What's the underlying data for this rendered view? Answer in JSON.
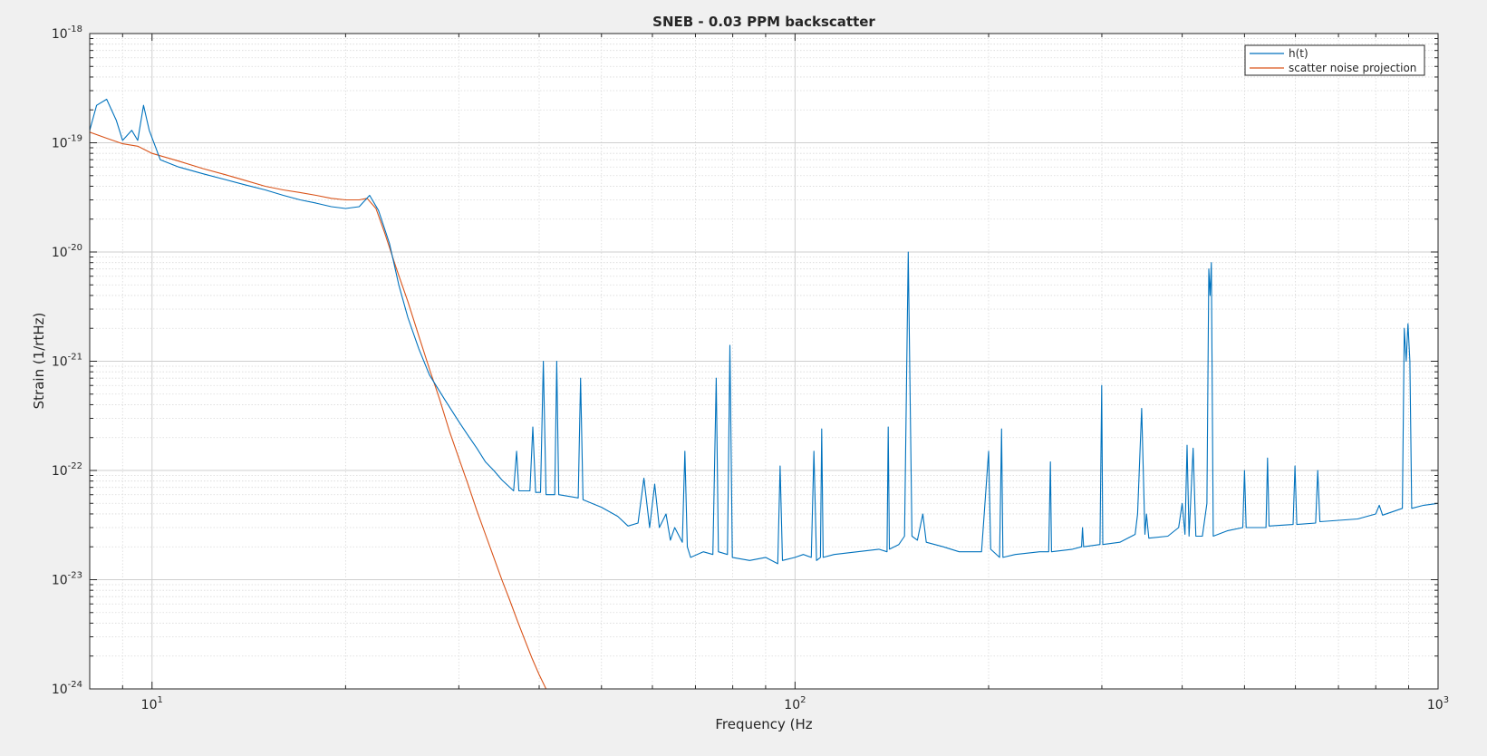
{
  "chart_data": {
    "type": "line",
    "title": "SNEB - 0.03 PPM backscatter",
    "xlabel": "Frequency (Hz",
    "ylabel": "Strain (1/rtHz)",
    "xscale": "log",
    "yscale": "log",
    "xlim": [
      8,
      1000
    ],
    "ylim": [
      1e-24,
      1e-18
    ],
    "grid": true,
    "minor_grid": true,
    "legend_position": "top-right",
    "x_ticks": [
      {
        "value": 10,
        "base": "10",
        "exp": "1"
      },
      {
        "value": 100,
        "base": "10",
        "exp": "2"
      },
      {
        "value": 1000,
        "base": "10",
        "exp": "3"
      }
    ],
    "y_ticks": [
      {
        "value": 1e-18,
        "base": "10",
        "exp": "-18"
      },
      {
        "value": 1e-19,
        "base": "10",
        "exp": "-19"
      },
      {
        "value": 1e-20,
        "base": "10",
        "exp": "-20"
      },
      {
        "value": 1e-21,
        "base": "10",
        "exp": "-21"
      },
      {
        "value": 1e-22,
        "base": "10",
        "exp": "-22"
      },
      {
        "value": 1e-23,
        "base": "10",
        "exp": "-23"
      },
      {
        "value": 1e-24,
        "base": "10",
        "exp": "-24"
      }
    ],
    "series": [
      {
        "name": "h(t)",
        "color": "#0072bd",
        "points": [
          [
            8,
            1.3e-19
          ],
          [
            8.2,
            2.2e-19
          ],
          [
            8.5,
            2.5e-19
          ],
          [
            8.8,
            1.6e-19
          ],
          [
            9.0,
            1.05e-19
          ],
          [
            9.3,
            1.3e-19
          ],
          [
            9.5,
            1.05e-19
          ],
          [
            9.7,
            2.2e-19
          ],
          [
            9.9,
            1.3e-19
          ],
          [
            10.3,
            7e-20
          ],
          [
            11,
            6e-20
          ],
          [
            12,
            5.2e-20
          ],
          [
            13,
            4.6e-20
          ],
          [
            14,
            4.1e-20
          ],
          [
            15,
            3.7e-20
          ],
          [
            16,
            3.3e-20
          ],
          [
            17,
            3e-20
          ],
          [
            18,
            2.8e-20
          ],
          [
            19,
            2.6e-20
          ],
          [
            20,
            2.5e-20
          ],
          [
            21,
            2.6e-20
          ],
          [
            21.8,
            3.3e-20
          ],
          [
            22.5,
            2.4e-20
          ],
          [
            23.4,
            1.2e-20
          ],
          [
            24.2,
            5e-21
          ],
          [
            25,
            2.5e-21
          ],
          [
            26,
            1.3e-21
          ],
          [
            27,
            7.5e-22
          ],
          [
            28.5,
            4.5e-22
          ],
          [
            30,
            2.8e-22
          ],
          [
            31,
            2.1e-22
          ],
          [
            32,
            1.6e-22
          ],
          [
            33,
            1.2e-22
          ],
          [
            34,
            1e-22
          ],
          [
            35,
            8.2e-23
          ],
          [
            36.5,
            6.5e-23
          ],
          [
            36.9,
            1.5e-22
          ],
          [
            37.2,
            6.5e-23
          ],
          [
            38.7,
            6.5e-23
          ],
          [
            39.1,
            2.5e-22
          ],
          [
            39.5,
            6.3e-23
          ],
          [
            40.2,
            6.3e-23
          ],
          [
            40.6,
            1e-21
          ],
          [
            41.0,
            6e-23
          ],
          [
            42.3,
            6e-23
          ],
          [
            42.6,
            1e-21
          ],
          [
            42.9,
            6e-23
          ],
          [
            46,
            5.6e-23
          ],
          [
            46.4,
            7e-22
          ],
          [
            46.8,
            5.4e-23
          ],
          [
            50,
            4.6e-23
          ],
          [
            53,
            3.8e-23
          ],
          [
            55,
            3.1e-23
          ],
          [
            57,
            3.3e-23
          ],
          [
            58.2,
            8.5e-23
          ],
          [
            59.4,
            3e-23
          ],
          [
            60.5,
            7.5e-23
          ],
          [
            61.5,
            3e-23
          ],
          [
            63,
            4e-23
          ],
          [
            64,
            2.3e-23
          ],
          [
            65,
            3e-23
          ],
          [
            66.8,
            2.2e-23
          ],
          [
            67.4,
            1.5e-22
          ],
          [
            68,
            2e-23
          ],
          [
            68.8,
            1.6e-23
          ],
          [
            72,
            1.8e-23
          ],
          [
            74.5,
            1.7e-23
          ],
          [
            75.4,
            7e-22
          ],
          [
            76.0,
            1.8e-23
          ],
          [
            78.5,
            1.7e-23
          ],
          [
            79.2,
            1.4e-21
          ],
          [
            79.9,
            1.6e-23
          ],
          [
            85,
            1.5e-23
          ],
          [
            90,
            1.6e-23
          ],
          [
            94,
            1.4e-23
          ],
          [
            94.8,
            1.1e-22
          ],
          [
            95.6,
            1.5e-23
          ],
          [
            100,
            1.6e-23
          ],
          [
            103,
            1.7e-23
          ],
          [
            106,
            1.6e-23
          ],
          [
            107,
            1.5e-22
          ],
          [
            108,
            1.5e-23
          ],
          [
            109.5,
            1.6e-23
          ],
          [
            110,
            2.4e-22
          ],
          [
            110.6,
            1.6e-23
          ],
          [
            115,
            1.7e-23
          ],
          [
            125,
            1.8e-23
          ],
          [
            135,
            1.9e-23
          ],
          [
            139,
            1.8e-23
          ],
          [
            139.6,
            2.5e-22
          ],
          [
            140.2,
            1.9e-23
          ],
          [
            145,
            2.1e-23
          ],
          [
            148,
            2.5e-23
          ],
          [
            150,
            1e-20
          ],
          [
            152,
            2.5e-23
          ],
          [
            155,
            2.3e-23
          ],
          [
            158,
            4e-23
          ],
          [
            160,
            2.2e-23
          ],
          [
            170,
            2e-23
          ],
          [
            180,
            1.8e-23
          ],
          [
            195,
            1.8e-23
          ],
          [
            198.5,
            8e-23
          ],
          [
            200,
            1.5e-22
          ],
          [
            201.5,
            1.9e-23
          ],
          [
            208,
            1.6e-23
          ],
          [
            209.5,
            2.4e-22
          ],
          [
            210.5,
            1.6e-23
          ],
          [
            220,
            1.7e-23
          ],
          [
            240,
            1.8e-23
          ],
          [
            248,
            1.8e-23
          ],
          [
            249.5,
            1.2e-22
          ],
          [
            250.5,
            1.8e-23
          ],
          [
            270,
            1.9e-23
          ],
          [
            279,
            2e-23
          ],
          [
            279.9,
            3e-23
          ],
          [
            281,
            2e-23
          ],
          [
            298,
            2.1e-23
          ],
          [
            299.8,
            6e-22
          ],
          [
            301,
            2.1e-23
          ],
          [
            320,
            2.2e-23
          ],
          [
            338,
            2.6e-23
          ],
          [
            341,
            4e-23
          ],
          [
            346,
            3.7e-22
          ],
          [
            350,
            2.6e-23
          ],
          [
            352,
            4e-23
          ],
          [
            355,
            2.4e-23
          ],
          [
            380,
            2.5e-23
          ],
          [
            395,
            3e-23
          ],
          [
            400,
            5e-23
          ],
          [
            404,
            2.6e-23
          ],
          [
            407,
            1.7e-22
          ],
          [
            410,
            2.5e-23
          ],
          [
            416,
            1.6e-22
          ],
          [
            420,
            2.5e-23
          ],
          [
            430,
            2.5e-23
          ],
          [
            437,
            5e-23
          ],
          [
            440,
            7e-21
          ],
          [
            442,
            4e-21
          ],
          [
            444,
            8e-21
          ],
          [
            447,
            2.5e-23
          ],
          [
            470,
            2.8e-23
          ],
          [
            497,
            3e-23
          ],
          [
            500,
            1e-22
          ],
          [
            503,
            3e-23
          ],
          [
            540,
            3e-23
          ],
          [
            543,
            1.3e-22
          ],
          [
            546,
            3.1e-23
          ],
          [
            595,
            3.2e-23
          ],
          [
            599,
            1.1e-22
          ],
          [
            603,
            3.2e-23
          ],
          [
            645,
            3.3e-23
          ],
          [
            650,
            1e-22
          ],
          [
            655,
            3.4e-23
          ],
          [
            750,
            3.6e-23
          ],
          [
            800,
            4e-23
          ],
          [
            810,
            4.8e-23
          ],
          [
            820,
            3.9e-23
          ],
          [
            880,
            4.5e-23
          ],
          [
            886,
            2e-21
          ],
          [
            892,
            1e-21
          ],
          [
            898,
            2.2e-21
          ],
          [
            904,
            1e-21
          ],
          [
            910,
            4.5e-23
          ],
          [
            950,
            4.8e-23
          ],
          [
            1000,
            5e-23
          ]
        ]
      },
      {
        "name": "scatter noise projection",
        "color": "#d95319",
        "points": [
          [
            8,
            1.25e-19
          ],
          [
            8.5,
            1.1e-19
          ],
          [
            9,
            9.8e-20
          ],
          [
            9.5,
            9.3e-20
          ],
          [
            10,
            8e-20
          ],
          [
            11,
            6.8e-20
          ],
          [
            12,
            5.8e-20
          ],
          [
            13,
            5.1e-20
          ],
          [
            14,
            4.5e-20
          ],
          [
            15,
            4e-20
          ],
          [
            16,
            3.7e-20
          ],
          [
            17,
            3.5e-20
          ],
          [
            18,
            3.3e-20
          ],
          [
            19,
            3.1e-20
          ],
          [
            20,
            3e-20
          ],
          [
            21,
            3e-20
          ],
          [
            21.6,
            3.1e-20
          ],
          [
            22.3,
            2.5e-20
          ],
          [
            23,
            1.5e-20
          ],
          [
            24,
            7e-21
          ],
          [
            25,
            3.5e-21
          ],
          [
            26,
            1.7e-21
          ],
          [
            27,
            8.5e-22
          ],
          [
            28,
            4.5e-22
          ],
          [
            29,
            2.3e-22
          ],
          [
            30,
            1.3e-22
          ],
          [
            31,
            7.5e-23
          ],
          [
            32,
            4.3e-23
          ],
          [
            33,
            2.6e-23
          ],
          [
            34,
            1.6e-23
          ],
          [
            35,
            1e-23
          ],
          [
            36,
            6.5e-24
          ],
          [
            37,
            4.2e-24
          ],
          [
            38,
            2.8e-24
          ],
          [
            39,
            1.9e-24
          ],
          [
            40,
            1.35e-24
          ],
          [
            41,
            1e-24
          ]
        ]
      }
    ]
  }
}
